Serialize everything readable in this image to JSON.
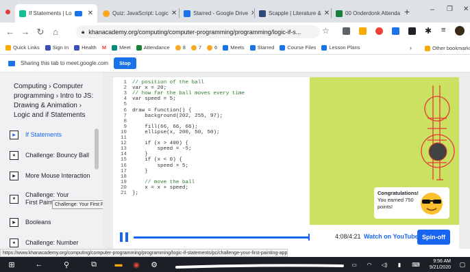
{
  "tabs": [
    {
      "label": "If Statements | Lo",
      "color": "#14bf96",
      "active": true
    },
    {
      "label": "Quiz: JavaScript: Logic",
      "color": "#f9a825"
    },
    {
      "label": "Starred - Google Drive",
      "color": "#1a73e8"
    },
    {
      "label": "Scapple | Literature &",
      "color": "#2d4a7a"
    },
    {
      "label": "00 Onderdonk Attenda",
      "color": "#188038"
    }
  ],
  "omnibox": {
    "url": "khanacademy.org/computing/computer-programming/programming/logic-if-s..."
  },
  "bookmarks": [
    {
      "label": "Quick Links",
      "color": "#f9ab00"
    },
    {
      "label": "Sign In",
      "color": "#3c4fb2"
    },
    {
      "label": "Health",
      "color": "#3c4fb2"
    },
    {
      "label": "M",
      "color": "#ea4335"
    },
    {
      "label": "Meet",
      "color": "#00897b"
    },
    {
      "label": "Attendance",
      "color": "#188038"
    },
    {
      "label": "8",
      "color": "#f9a825"
    },
    {
      "label": "7",
      "color": "#f9a825"
    },
    {
      "label": "6",
      "color": "#f9a825"
    },
    {
      "label": "Meets",
      "color": "#1a73e8"
    },
    {
      "label": "Starred",
      "color": "#1a73e8"
    },
    {
      "label": "Course Files",
      "color": "#1a73e8"
    },
    {
      "label": "Lesson Plans",
      "color": "#1a73e8"
    },
    {
      "label": "Other bookmarks",
      "color": "#f9ab00"
    }
  ],
  "share": {
    "text": "Sharing this tab to meet.google.com",
    "stop": "Stop"
  },
  "sidebar": {
    "breadcrumb": "Computing › Computer programming › Intro to JS: Drawing & Animation › Logic and if Statements",
    "items": [
      {
        "label": "If Statements",
        "icon": "video-icon",
        "current": true
      },
      {
        "label": "Challenge: Bouncy Ball",
        "icon": "challenge-star-icon"
      },
      {
        "label": "More Mouse Interaction",
        "icon": "video-icon"
      },
      {
        "label": "Challenge: Your First Painting",
        "icon": "challenge-star-icon"
      },
      {
        "label": "Booleans",
        "icon": "video-icon"
      },
      {
        "label": "Challenge: Number",
        "icon": "challenge-star-icon"
      }
    ],
    "tooltip": "Challenge: Your First Painting App"
  },
  "code": [
    "// position of the ball",
    "var x = 20;",
    "// how far the ball moves every time",
    "var speed = 5;",
    "",
    "draw = function() {",
    "    background(202, 255, 97);",
    "",
    "    fill(66, 66, 66);",
    "    ellipse(x, 200, 50, 50);",
    "",
    "    if (x > 400) {",
    "        speed = -5;",
    "    }",
    "    if (x < 0) {",
    "        speed = 5;",
    "    }",
    "",
    "    // move the ball",
    "    x = x + speed;",
    "};"
  ],
  "congrats": {
    "title": "Congratulations!",
    "body": "You earned 750 points!"
  },
  "player": {
    "time": "4:08/4:21",
    "youtube": "Watch on YouTube",
    "spinoff": "Spin-off",
    "progress": 0.95
  },
  "status_url": "https://www.khanacademy.org/computing/computer-programming/programming/logic-if-statements/pc/challenge-your-first-painting-app",
  "clock": {
    "time": "9:56 AM",
    "date": "9/21/2020"
  },
  "colors": {
    "ka_blue": "#1865f2",
    "canvas_bg": "#cae161",
    "ball": "#424242",
    "annotation": "#e53935"
  }
}
